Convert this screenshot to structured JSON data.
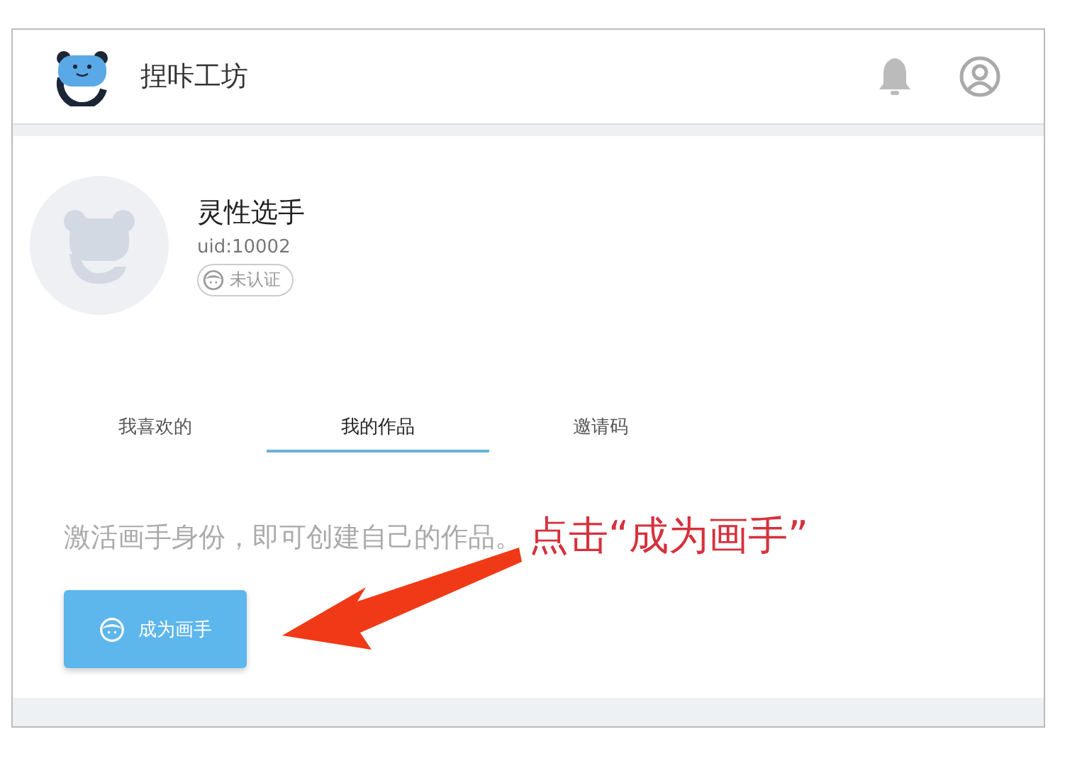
{
  "header": {
    "title": "捏咔工坊"
  },
  "profile": {
    "name": "灵性选手",
    "uid": "uid:10002",
    "badge": "未认证"
  },
  "tabs": [
    {
      "label": "我喜欢的",
      "selected": false
    },
    {
      "label": "我的作品",
      "selected": true
    },
    {
      "label": "邀请码",
      "selected": false
    }
  ],
  "content": {
    "hint": "激活画手身份，即可创建自己的作品。",
    "button": "成为画手"
  },
  "annotation": {
    "text": "点击“成为画手”"
  }
}
